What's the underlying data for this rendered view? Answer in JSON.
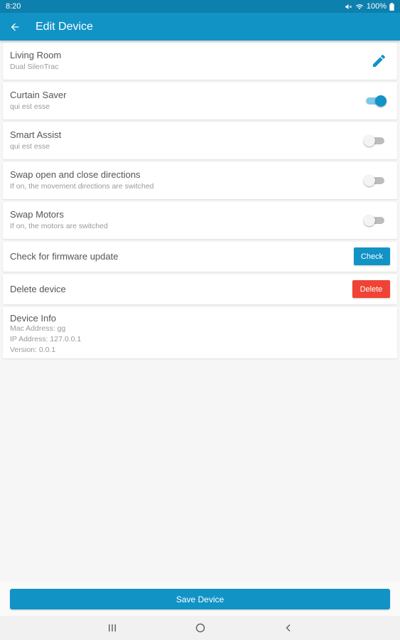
{
  "status_bar": {
    "time": "8:20",
    "battery": "100%",
    "icons": [
      "mute-icon",
      "wifi-icon",
      "battery-icon"
    ]
  },
  "app_bar": {
    "title": "Edit Device",
    "back_icon": "arrow-left-icon"
  },
  "device": {
    "name": "Living Room",
    "model": "Dual SilenTrac",
    "edit_icon": "pencil-icon"
  },
  "settings": [
    {
      "key": "curtain_saver",
      "title": "Curtain Saver",
      "subtitle": "qui est esse",
      "enabled": true
    },
    {
      "key": "smart_assist",
      "title": "Smart Assist",
      "subtitle": "qui est esse",
      "enabled": false
    },
    {
      "key": "swap_directions",
      "title": "Swap open and close directions",
      "subtitle": "If on, the movement directions are switched",
      "enabled": false
    },
    {
      "key": "swap_motors",
      "title": "Swap Motors",
      "subtitle": "If on, the motors are switched",
      "enabled": false
    }
  ],
  "firmware": {
    "label": "Check for firmware update",
    "button_label": "Check"
  },
  "delete": {
    "label": "Delete device",
    "button_label": "Delete"
  },
  "device_info": {
    "title": "Device Info",
    "lines": [
      "Mac Address: gg",
      "IP Address: 127.0.0.1",
      "Version: 0.0.1"
    ]
  },
  "save_button_label": "Save Device",
  "colors": {
    "primary": "#1193c6",
    "status_bar": "#0e80ad",
    "danger": "#f04335",
    "background": "#f6f6f6"
  },
  "nav_bar": {
    "items": [
      "recent-apps-icon",
      "home-icon",
      "back-icon"
    ]
  }
}
